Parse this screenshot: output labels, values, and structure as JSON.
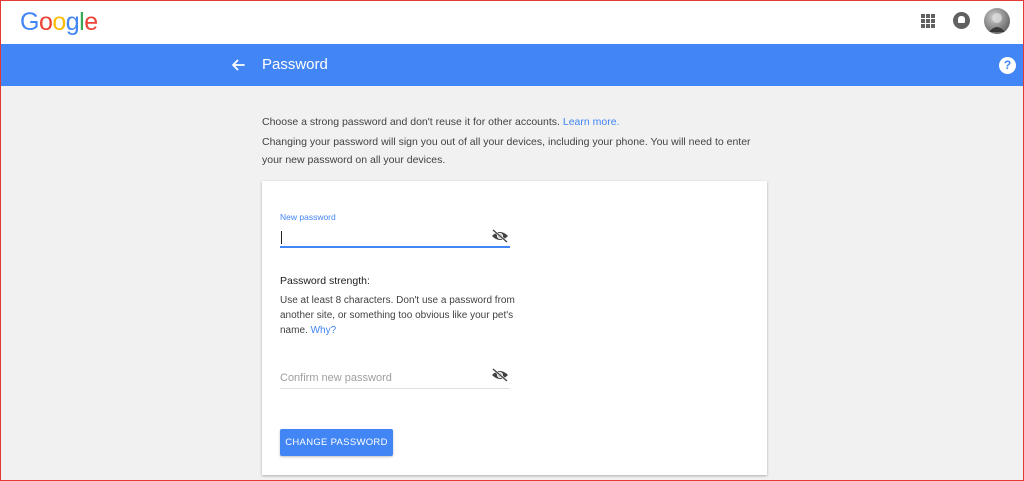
{
  "app": {
    "logo_letters": [
      "G",
      "o",
      "o",
      "g",
      "l",
      "e"
    ]
  },
  "header": {
    "title": "Password"
  },
  "intro": {
    "line1_text": "Choose a strong password and don't reuse it for other accounts.",
    "learn_more_label": "Learn more.",
    "line2_text": "Changing your password will sign you out of all your devices, including your phone. You will need to enter your new password on all your devices."
  },
  "form": {
    "new_password_label": "New password",
    "new_password_value": "",
    "strength_title": "Password strength:",
    "strength_desc": "Use at least 8 characters. Don't use a password from another site, or something too obvious like your pet's name.",
    "why_link": "Why?",
    "confirm_placeholder": "Confirm new password",
    "submit_label": "CHANGE PASSWORD"
  },
  "icons": {
    "back": "arrow-back-icon",
    "apps": "apps-grid-icon",
    "notifications": "notifications-icon",
    "help": "help-icon",
    "visibility": "visibility-off-icon"
  },
  "colors": {
    "brand_blue": "#4285f4",
    "google_red": "#ea4335",
    "google_yellow": "#fbbc05",
    "google_green": "#34a853",
    "background": "#f1f1f1"
  }
}
